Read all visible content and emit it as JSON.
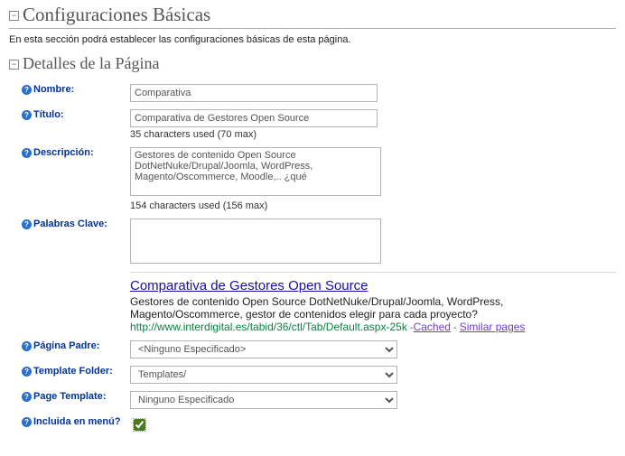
{
  "section_title": "Configuraciones Básicas",
  "intro": "En esta sección podrá establecer las configuraciones básicas de esta página.",
  "subsection_title": "Detalles de la Página",
  "labels": {
    "nombre": "Nombre:",
    "titulo": "Título:",
    "descripcion": "Descripción:",
    "palabras": "Palabras Clave:",
    "pagina_padre": "Página Padre:",
    "template_folder": "Template Folder:",
    "page_template": "Page Template:",
    "incluida": "Incluida en menú?"
  },
  "fields": {
    "nombre": "Comparativa",
    "titulo": "Comparativa de Gestores Open Source",
    "titulo_counter": "35 characters used  (70 max)",
    "descripcion": "Gestores de contenido Open Source DotNetNuke/Drupal/Joomla, WordPress, Magento/Oscommerce, Moodle,.. ¿qué",
    "descripcion_counter": "154 characters used  (156 max)",
    "palabras": "",
    "pagina_padre": "<Ninguno Especificado>",
    "template_folder": "Templates/",
    "page_template": "Ninguno Especificado",
    "incluida": true
  },
  "serp": {
    "title": "Comparativa de Gestores Open Source",
    "desc": "Gestores de contenido Open Source DotNetNuke/Drupal/Joomla, WordPress, Magento/Oscommerce, gestor de contenidos elegir para cada proyecto?",
    "url": "http://www.interdigital.es/tabid/36/ctl/Tab/Default.aspx-25k",
    "cached": "Cached",
    "similar": "Similar pages"
  }
}
